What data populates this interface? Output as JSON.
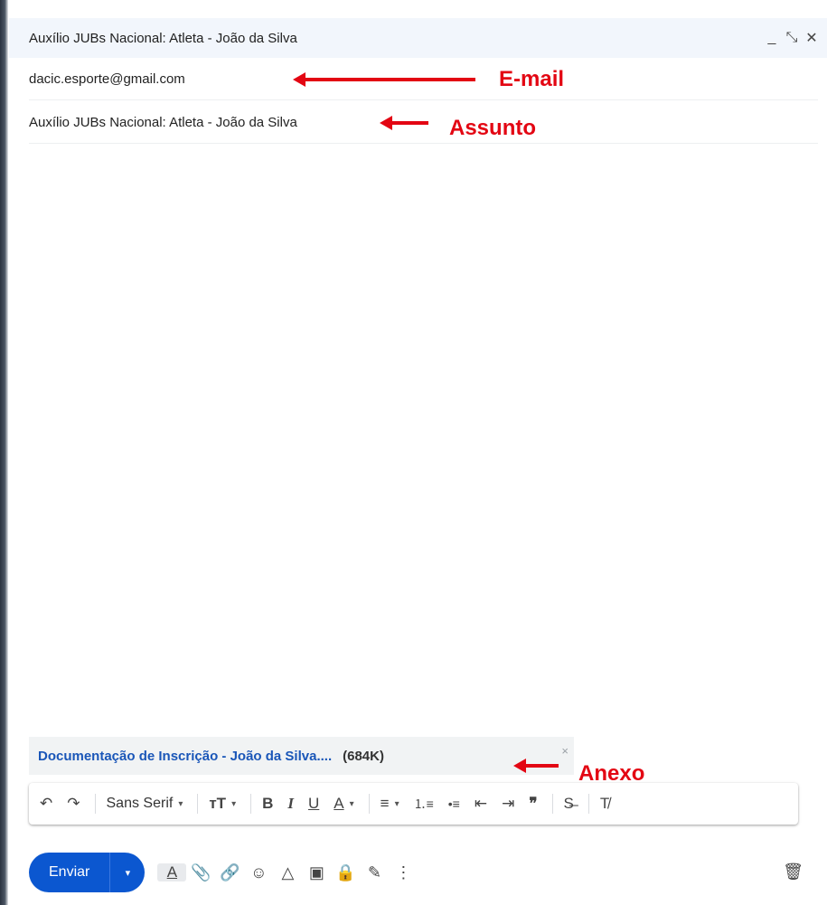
{
  "window": {
    "title": "Auxílio JUBs Nacional: Atleta - João da Silva",
    "controls": [
      "_",
      "⤡",
      "✕"
    ]
  },
  "compose": {
    "to_value": "dacic.esporte@gmail.com",
    "subject_value": "Auxílio JUBs Nacional: Atleta - João da Silva",
    "body_value": ""
  },
  "attachment": {
    "name": "Documentação de Inscrição - João da Silva....",
    "size": "(684K)",
    "close": "×"
  },
  "format_toolbar": {
    "undo": "↶",
    "redo": "↷",
    "font": "Sans Serif",
    "caret": "▾",
    "size": "тT",
    "bold": "B",
    "italic": "I",
    "underline": "U",
    "text_color": "A",
    "align": "≡",
    "numbered_list": "⒈≡",
    "bulleted_list": "•≡",
    "indent_less": "⇤",
    "indent_more": "⇥",
    "quote": "❞",
    "strikethrough": "S̶",
    "clear_formatting": "T̸"
  },
  "bottom_bar": {
    "send_label": "Enviar",
    "send_caret": "▾",
    "icons": [
      "A",
      "📎",
      "🔗",
      "☺",
      "△",
      "▣",
      "🔒",
      "✎",
      "⋮"
    ],
    "trash": "🗑"
  },
  "annotations": {
    "email": "E-mail",
    "subject": "Assunto",
    "attachment": "Anexo"
  },
  "colors": {
    "annotation": "#e30613",
    "send_button": "#0b57d0",
    "attachment_link": "#1a56b8"
  }
}
